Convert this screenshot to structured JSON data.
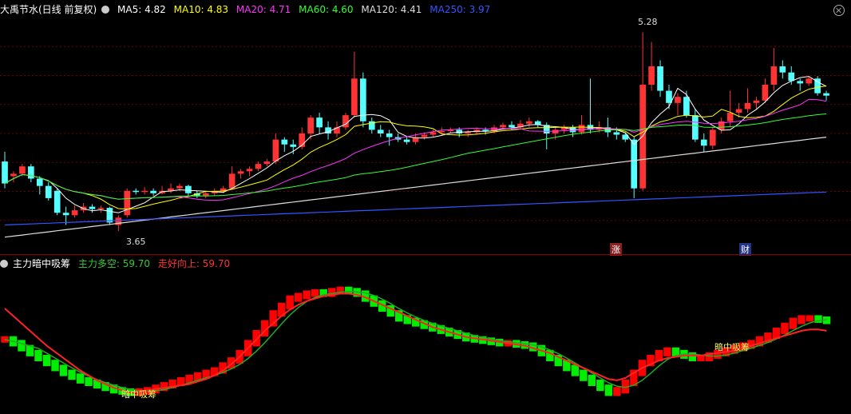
{
  "main_header": {
    "title": "大禹节水(日线 前复权)",
    "ma": [
      {
        "label": "MA5: 4.82",
        "color": "#ffffff"
      },
      {
        "label": "MA10: 4.83",
        "color": "#ffff00"
      },
      {
        "label": "MA20: 4.71",
        "color": "#ff33ff"
      },
      {
        "label": "MA60: 4.60",
        "color": "#33ff33"
      },
      {
        "label": "MA120: 4.41",
        "color": "#dddddd"
      },
      {
        "label": "MA250: 3.97",
        "color": "#3355ff"
      }
    ]
  },
  "sub_header": {
    "title": "主力暗中吸筹",
    "line1": "主力多空: 59.70",
    "line1_color": "#33cc33",
    "line2": "走好向上: 59.70",
    "line2_color": "#ff3333"
  },
  "markers": {
    "high": "5.28",
    "low": "3.65",
    "zhang": "涨",
    "cai": "财",
    "signal1": "暗中吸筹",
    "signal2": "暗中吸筹"
  },
  "chart_data": [
    {
      "type": "candlestick",
      "ylim": [
        3.5,
        5.4
      ],
      "high_label": 5.28,
      "low_label": 3.65,
      "ma": {
        "MA5": 4.82,
        "MA10": 4.83,
        "MA20": 4.71,
        "MA60": 4.6,
        "MA120": 4.41,
        "MA250": 3.97
      },
      "colors": {
        "up": "#ff3333",
        "down": "#55ffff"
      },
      "candles": [
        [
          4.22,
          4.04,
          4.3,
          4.0
        ],
        [
          4.1,
          4.12,
          4.14,
          4.05
        ],
        [
          4.12,
          4.18,
          4.2,
          4.1
        ],
        [
          4.18,
          4.08,
          4.2,
          4.05
        ],
        [
          4.08,
          4.02,
          4.1,
          3.95
        ],
        [
          4.02,
          3.92,
          4.05,
          3.9
        ],
        [
          3.98,
          3.8,
          4.0,
          3.78
        ],
        [
          3.8,
          3.78,
          3.85,
          3.7
        ],
        [
          3.78,
          3.82,
          3.86,
          3.76
        ],
        [
          3.82,
          3.85,
          3.88,
          3.8
        ],
        [
          3.85,
          3.83,
          3.87,
          3.8
        ],
        [
          3.83,
          3.84,
          3.86,
          3.8
        ],
        [
          3.84,
          3.72,
          3.85,
          3.7
        ],
        [
          3.7,
          3.76,
          3.78,
          3.65
        ],
        [
          3.78,
          3.98,
          4.0,
          3.76
        ],
        [
          3.98,
          3.97,
          4.0,
          3.95
        ],
        [
          3.97,
          3.98,
          4.01,
          3.95
        ],
        [
          3.98,
          3.96,
          4.0,
          3.94
        ],
        [
          3.96,
          3.98,
          4.02,
          3.95
        ],
        [
          3.98,
          4.0,
          4.04,
          3.96
        ],
        [
          4.0,
          4.02,
          4.04,
          3.98
        ],
        [
          4.02,
          3.96,
          4.03,
          3.94
        ],
        [
          3.96,
          3.94,
          3.98,
          3.92
        ],
        [
          3.94,
          3.96,
          3.98,
          3.92
        ],
        [
          3.96,
          3.98,
          4.0,
          3.94
        ],
        [
          3.98,
          4.0,
          4.02,
          3.96
        ],
        [
          4.0,
          4.12,
          4.18,
          3.99
        ],
        [
          4.12,
          4.14,
          4.16,
          4.08
        ],
        [
          4.14,
          4.16,
          4.18,
          4.1
        ],
        [
          4.16,
          4.2,
          4.22,
          4.14
        ],
        [
          4.2,
          4.22,
          4.24,
          4.18
        ],
        [
          4.22,
          4.4,
          4.45,
          4.2
        ],
        [
          4.4,
          4.36,
          4.42,
          4.3
        ],
        [
          4.36,
          4.34,
          4.4,
          4.28
        ],
        [
          4.34,
          4.45,
          4.5,
          4.32
        ],
        [
          4.45,
          4.58,
          4.6,
          4.4
        ],
        [
          4.58,
          4.5,
          4.62,
          4.45
        ],
        [
          4.5,
          4.45,
          4.55,
          4.4
        ],
        [
          4.45,
          4.5,
          4.55,
          4.42
        ],
        [
          4.5,
          4.6,
          4.62,
          4.48
        ],
        [
          4.6,
          4.9,
          5.12,
          4.58
        ],
        [
          4.9,
          4.55,
          4.95,
          4.5
        ],
        [
          4.55,
          4.48,
          4.58,
          4.45
        ],
        [
          4.48,
          4.45,
          4.52,
          4.42
        ],
        [
          4.45,
          4.42,
          4.48,
          4.35
        ],
        [
          4.42,
          4.4,
          4.45,
          4.38
        ],
        [
          4.4,
          4.38,
          4.42,
          4.36
        ],
        [
          4.38,
          4.42,
          4.45,
          4.36
        ],
        [
          4.42,
          4.44,
          4.46,
          4.4
        ],
        [
          4.44,
          4.46,
          4.48,
          4.42
        ],
        [
          4.46,
          4.47,
          4.5,
          4.44
        ],
        [
          4.47,
          4.48,
          4.5,
          4.45
        ],
        [
          4.48,
          4.45,
          4.5,
          4.42
        ],
        [
          4.45,
          4.46,
          4.48,
          4.42
        ],
        [
          4.46,
          4.48,
          4.5,
          4.44
        ],
        [
          4.48,
          4.47,
          4.5,
          4.44
        ],
        [
          4.47,
          4.5,
          4.52,
          4.45
        ],
        [
          4.5,
          4.52,
          4.54,
          4.48
        ],
        [
          4.52,
          4.5,
          4.55,
          4.48
        ],
        [
          4.5,
          4.53,
          4.56,
          4.48
        ],
        [
          4.53,
          4.55,
          4.58,
          4.5
        ],
        [
          4.55,
          4.52,
          4.56,
          4.5
        ],
        [
          4.52,
          4.45,
          4.54,
          4.32
        ],
        [
          4.45,
          4.48,
          4.5,
          4.4
        ],
        [
          4.48,
          4.5,
          4.52,
          4.45
        ],
        [
          4.5,
          4.46,
          4.52,
          4.42
        ],
        [
          4.46,
          4.52,
          4.6,
          4.44
        ],
        [
          4.52,
          4.48,
          4.9,
          4.45
        ],
        [
          4.48,
          4.5,
          4.55,
          4.46
        ],
        [
          4.5,
          4.46,
          4.58,
          4.42
        ],
        [
          4.46,
          4.44,
          4.5,
          4.4
        ],
        [
          4.44,
          4.4,
          4.46,
          4.38
        ],
        [
          4.4,
          4.0,
          4.42,
          3.92
        ],
        [
          4.0,
          4.85,
          5.28,
          3.98
        ],
        [
          4.85,
          5.0,
          5.2,
          4.8
        ],
        [
          5.0,
          4.8,
          5.05,
          4.75
        ],
        [
          4.8,
          4.7,
          4.85,
          4.65
        ],
        [
          4.7,
          4.75,
          4.78,
          4.6
        ],
        [
          4.75,
          4.6,
          4.8,
          4.58
        ],
        [
          4.6,
          4.4,
          4.65,
          4.38
        ],
        [
          4.4,
          4.35,
          4.45,
          4.3
        ],
        [
          4.35,
          4.48,
          4.5,
          4.32
        ],
        [
          4.48,
          4.55,
          4.58,
          4.45
        ],
        [
          4.55,
          4.62,
          4.8,
          4.5
        ],
        [
          4.62,
          4.65,
          4.7,
          4.58
        ],
        [
          4.65,
          4.7,
          4.82,
          4.62
        ],
        [
          4.7,
          4.72,
          4.75,
          4.65
        ],
        [
          4.72,
          4.85,
          4.9,
          4.7
        ],
        [
          4.85,
          5.0,
          5.15,
          4.8
        ],
        [
          5.0,
          4.95,
          5.05,
          4.9
        ],
        [
          4.95,
          4.88,
          5.0,
          4.85
        ],
        [
          4.88,
          4.86,
          4.9,
          4.8
        ],
        [
          4.86,
          4.9,
          4.92,
          4.84
        ],
        [
          4.9,
          4.78,
          4.92,
          4.76
        ],
        [
          4.78,
          4.76,
          4.8,
          4.72
        ]
      ]
    },
    {
      "type": "bar",
      "ylim": [
        0,
        100
      ],
      "series": [
        {
          "name": "主力多空",
          "color_up": "#ff0000",
          "color_down": "#00ee00",
          "values": [
            55,
            52,
            48,
            44,
            40,
            36,
            32,
            28,
            25,
            22,
            20,
            18,
            16,
            14,
            13,
            12,
            13,
            14,
            16,
            18,
            20,
            22,
            24,
            26,
            28,
            30,
            34,
            38,
            44,
            52,
            60,
            68,
            76,
            82,
            88,
            90,
            92,
            93,
            92,
            94,
            95,
            94,
            92,
            88,
            84,
            80,
            76,
            72,
            70,
            68,
            66,
            64,
            62,
            60,
            58,
            56,
            55,
            54,
            53,
            52,
            52,
            51,
            50,
            48,
            44,
            40,
            36,
            32,
            28,
            24,
            20,
            16,
            12,
            14,
            20,
            28,
            36,
            40,
            44,
            46,
            44,
            42,
            40,
            40,
            42,
            44,
            46,
            48,
            50,
            52,
            55,
            58,
            62,
            66,
            70,
            72,
            72,
            71,
            70
          ]
        },
        {
          "name": "走好向上",
          "color": "#ff2222",
          "values": [
            80,
            74,
            68,
            62,
            56,
            50,
            45,
            40,
            35,
            30,
            26,
            22,
            19,
            16,
            14,
            12,
            13,
            14,
            15,
            16,
            17,
            18,
            19,
            21,
            23,
            26,
            30,
            35,
            41,
            48,
            55,
            62,
            68,
            74,
            79,
            83,
            86,
            88,
            90,
            91,
            92,
            92,
            91,
            89,
            86,
            83,
            80,
            77,
            74,
            71,
            68,
            65,
            63,
            61,
            59,
            57,
            56,
            55,
            54,
            53,
            52,
            51,
            50,
            48,
            46,
            44,
            41,
            38,
            35,
            32,
            29,
            26,
            23,
            22,
            24,
            28,
            32,
            35,
            38,
            40,
            41,
            42,
            42,
            42,
            43,
            44,
            45,
            46,
            48,
            50,
            52,
            54,
            56,
            58,
            60,
            62,
            63,
            63,
            62
          ]
        }
      ]
    }
  ]
}
